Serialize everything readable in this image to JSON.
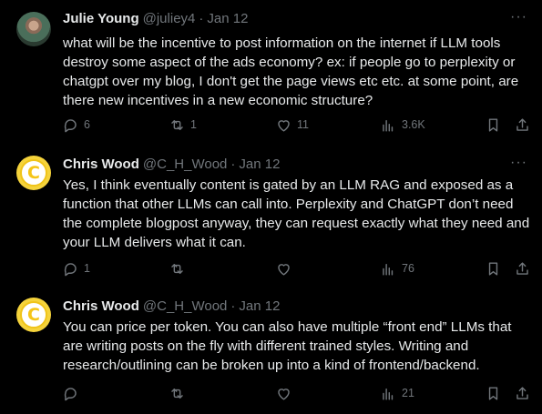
{
  "tweets": [
    {
      "name": "Julie Young",
      "handle": "@juliey4",
      "date": "Jan 12",
      "text": "what will be the incentive to post information on the internet if LLM tools destroy some aspect of the ads economy? ex: if people go to perplexity or chatgpt over my blog, I don't get the page views etc etc. at some point, are there new incentives in a new economic structure?",
      "replies": "6",
      "reposts": "1",
      "likes": "11",
      "views": "3.6K"
    },
    {
      "name": "Chris Wood",
      "handle": "@C_H_Wood",
      "date": "Jan 12",
      "avatar_letter": "C",
      "text": "Yes, I think eventually content is gated by an LLM RAG and exposed as a function that other LLMs can call into. Perplexity and ChatGPT don’t need the complete blogpost anyway, they can request exactly what they need and your LLM delivers what it can.",
      "replies": "1",
      "reposts": "",
      "likes": "",
      "views": "76"
    },
    {
      "name": "Chris Wood",
      "handle": "@C_H_Wood",
      "date": "Jan 12",
      "avatar_letter": "C",
      "text": "You can price per token. You can also have multiple “front end” LLMs that are writing posts on the fly with different trained styles. Writing and research/outlining can be broken up into a kind of frontend/backend.",
      "replies": "",
      "reposts": "",
      "likes": "",
      "views": "21"
    }
  ],
  "ui": {
    "more_glyph": "···",
    "dot": "·"
  }
}
